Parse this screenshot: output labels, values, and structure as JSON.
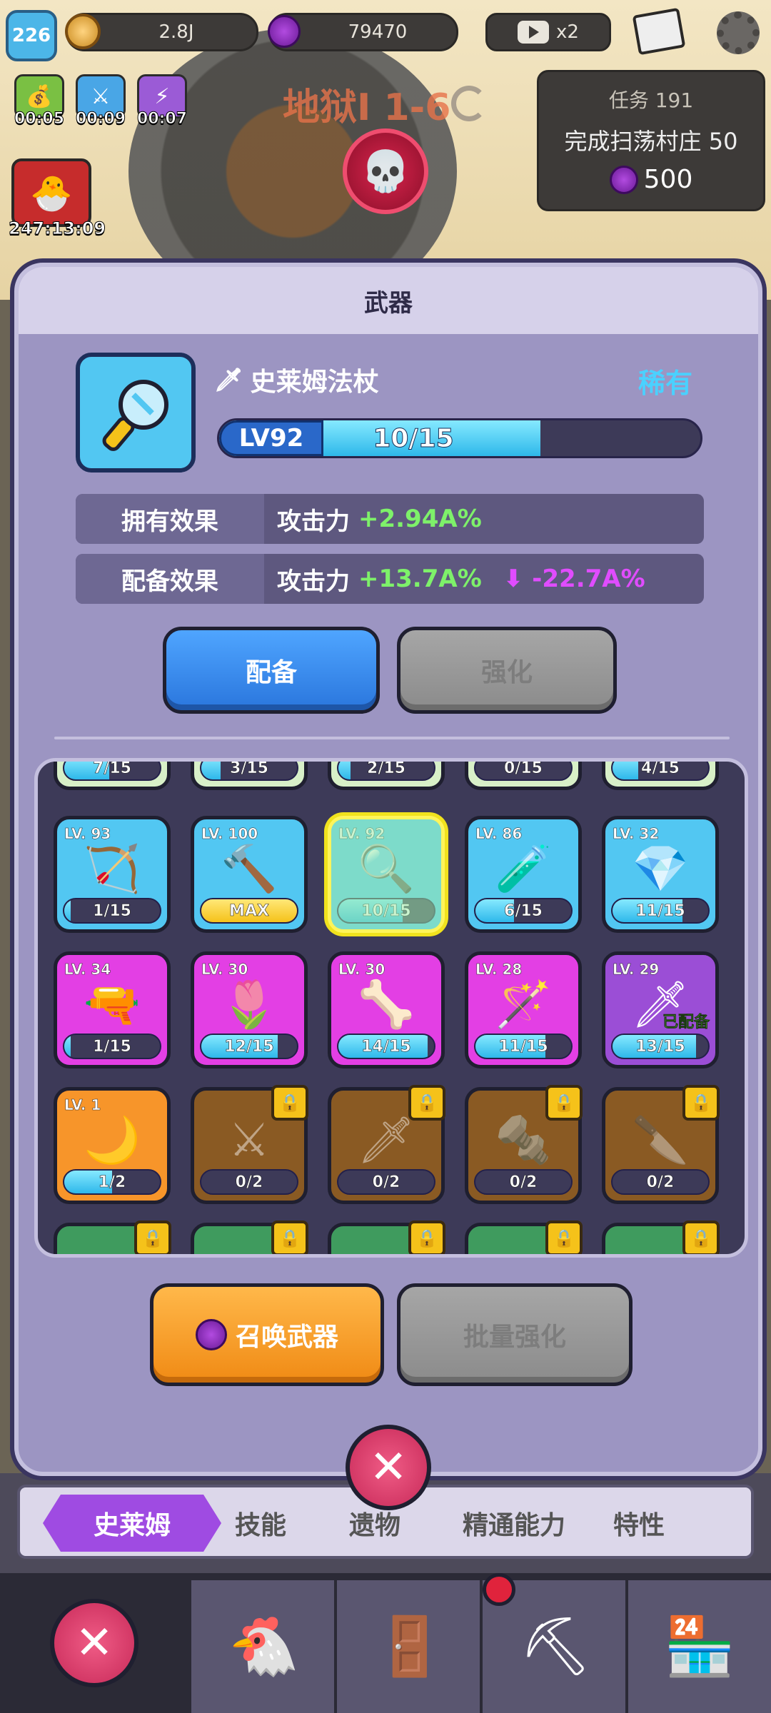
{
  "hud": {
    "player_level": "226",
    "gold": "2.8J",
    "gems": "79470",
    "video_multiplier": "x2",
    "buff_timers": [
      "00:05",
      "00:09",
      "00:07"
    ],
    "reward_timer": "247:13:09"
  },
  "stage": {
    "name": "地狱I 1-6"
  },
  "quest": {
    "title": "任务 191",
    "description": "完成扫荡村庄 50",
    "reward": "500"
  },
  "modal": {
    "title": "武器",
    "weapon": {
      "name": "史莱姆法杖",
      "rarity": "稀有",
      "level": "LV92",
      "progress_text": "10/15",
      "progress": 0.667
    },
    "owned_effect": {
      "label": "拥有效果",
      "stat": "攻击力",
      "value": "+2.94A%"
    },
    "equip_effect": {
      "label": "配备效果",
      "stat": "攻击力",
      "value": "+13.7A%",
      "diff": "-22.7A%"
    },
    "equip_button": "配备",
    "upgrade_button": "强化",
    "summon_button": "召唤武器",
    "bulk_upgrade_button": "批量强化"
  },
  "inventory": {
    "top_row_progress": [
      {
        "text": "7/15",
        "fill": 0.47
      },
      {
        "text": "3/15",
        "fill": 0.2
      },
      {
        "text": "2/15",
        "fill": 0.13
      },
      {
        "text": "0/15",
        "fill": 0
      },
      {
        "text": "4/15",
        "fill": 0.27
      }
    ],
    "rows": [
      [
        {
          "lv": "LV. 93",
          "text": "1/15",
          "fill": 0.07,
          "icon": "crossbow-icon",
          "glyph": "🏹",
          "color": "blue"
        },
        {
          "lv": "LV. 100",
          "text": "MAX",
          "fill": 1,
          "icon": "hammer-icon",
          "glyph": "🔨",
          "color": "blue",
          "max": true
        },
        {
          "lv": "LV. 92",
          "text": "10/15",
          "fill": 0.67,
          "icon": "slime-staff-icon",
          "glyph": "🔍",
          "color": "blue",
          "selected": true
        },
        {
          "lv": "LV. 86",
          "text": "6/15",
          "fill": 0.4,
          "icon": "bottle-staff-icon",
          "glyph": "🧪",
          "color": "blue"
        },
        {
          "lv": "LV. 32",
          "text": "11/15",
          "fill": 0.73,
          "icon": "crystal-hammer-icon",
          "glyph": "💎",
          "color": "blue"
        }
      ],
      [
        {
          "lv": "LV. 34",
          "text": "1/15",
          "fill": 0.07,
          "icon": "rifle-icon",
          "glyph": "🔫",
          "color": "pink"
        },
        {
          "lv": "LV. 30",
          "text": "12/15",
          "fill": 0.8,
          "icon": "flower-staff-icon",
          "glyph": "🌷",
          "color": "pink"
        },
        {
          "lv": "LV. 30",
          "text": "14/15",
          "fill": 0.93,
          "icon": "spiked-club-icon",
          "glyph": "🦴",
          "color": "pink"
        },
        {
          "lv": "LV. 28",
          "text": "11/15",
          "fill": 0.73,
          "icon": "magic-wand-icon",
          "glyph": "🪄",
          "color": "pink"
        },
        {
          "lv": "LV. 29",
          "text": "13/15",
          "fill": 0.87,
          "icon": "dagger-icon",
          "glyph": "🗡",
          "color": "purple",
          "equipped": "已配备"
        }
      ],
      [
        {
          "lv": "LV. 1",
          "text": "1/2",
          "fill": 0.5,
          "icon": "sickle-icon",
          "glyph": "🌙",
          "color": "orange"
        },
        {
          "lv": "",
          "text": "0/2",
          "fill": 0,
          "icon": "dark-blade-icon",
          "glyph": "⚔",
          "color": "brown",
          "locked": true
        },
        {
          "lv": "",
          "text": "0/2",
          "fill": 0,
          "icon": "katana-icon",
          "glyph": "🗡",
          "color": "brown",
          "locked": true
        },
        {
          "lv": "",
          "text": "0/2",
          "fill": 0,
          "icon": "drill-icon",
          "glyph": "🔩",
          "color": "brown",
          "locked": true
        },
        {
          "lv": "",
          "text": "0/2",
          "fill": 0,
          "icon": "red-blade-icon",
          "glyph": "🔪",
          "color": "brown",
          "locked": true
        }
      ],
      [
        {
          "lv": "",
          "text": "",
          "fill": 0,
          "icon": "locked-weapon-icon",
          "glyph": "",
          "color": "green",
          "locked": true
        },
        {
          "lv": "",
          "text": "",
          "fill": 0,
          "icon": "locked-weapon-icon",
          "glyph": "",
          "color": "green",
          "locked": true
        },
        {
          "lv": "",
          "text": "",
          "fill": 0,
          "icon": "locked-weapon-icon",
          "glyph": "",
          "color": "green",
          "locked": true
        },
        {
          "lv": "",
          "text": "",
          "fill": 0,
          "icon": "locked-weapon-icon",
          "glyph": "",
          "color": "green",
          "locked": true
        },
        {
          "lv": "",
          "text": "",
          "fill": 0,
          "icon": "locked-weapon-icon",
          "glyph": "",
          "color": "green",
          "locked": true
        }
      ]
    ]
  },
  "tabs": [
    {
      "label": "史莱姆",
      "active": true
    },
    {
      "label": "技能"
    },
    {
      "label": "遗物"
    },
    {
      "label": "精通能力"
    },
    {
      "label": "特性"
    }
  ],
  "dock": [
    {
      "icon": "close-icon"
    },
    {
      "icon": "chicken-icon"
    },
    {
      "icon": "portal-icon"
    },
    {
      "icon": "mining-icon"
    },
    {
      "icon": "shop-icon"
    }
  ]
}
